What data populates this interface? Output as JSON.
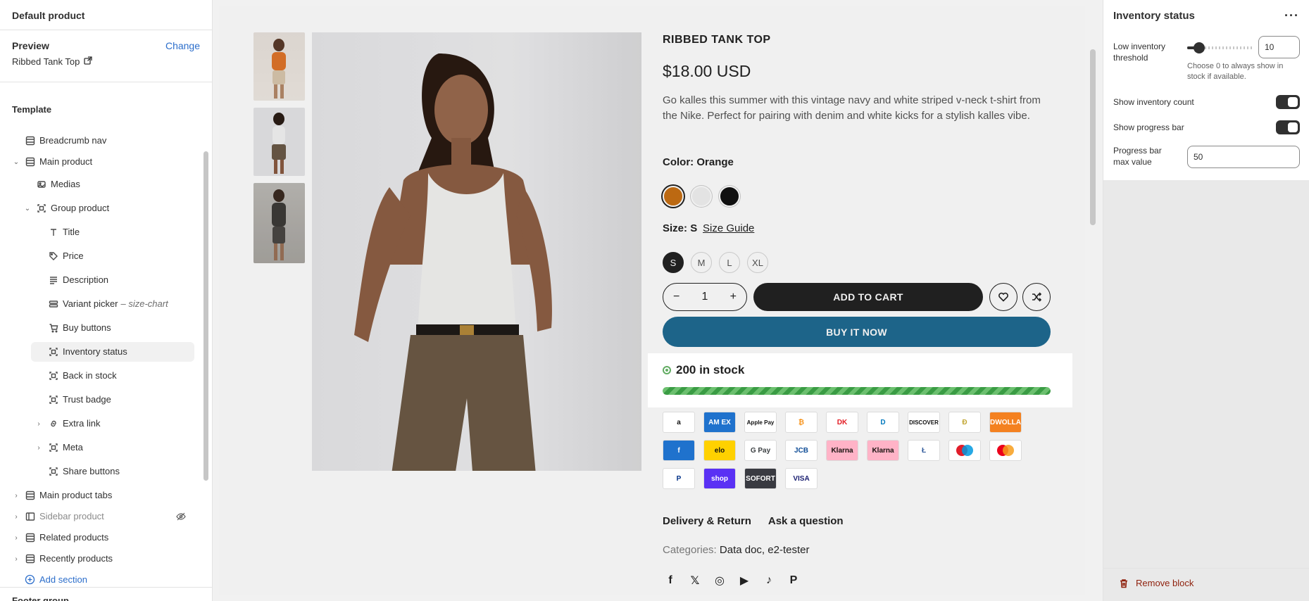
{
  "left_panel": {
    "title": "Default product",
    "preview_label": "Preview",
    "change_label": "Change",
    "preview_product": "Ribbed Tank Top",
    "template_label": "Template",
    "tree": [
      {
        "label": "Breadcrumb nav",
        "icon": "section-icon",
        "level": 1
      },
      {
        "label": "Main product",
        "icon": "section-icon",
        "level": 1,
        "expanded": true
      },
      {
        "label": "Medias",
        "icon": "media-icon",
        "level": 2
      },
      {
        "label": "Group product",
        "icon": "block-icon",
        "level": 2,
        "expanded": true
      },
      {
        "label": "Title",
        "icon": "text-icon",
        "level": 3
      },
      {
        "label": "Price",
        "icon": "price-tag-icon",
        "level": 3
      },
      {
        "label": "Description",
        "icon": "paragraph-icon",
        "level": 3
      },
      {
        "label": "Variant picker",
        "meta": "– size-chart",
        "icon": "variant-icon",
        "level": 3
      },
      {
        "label": "Buy buttons",
        "icon": "cart-icon",
        "level": 3
      },
      {
        "label": "Inventory status",
        "icon": "block-icon",
        "level": 3,
        "selected": true
      },
      {
        "label": "Back in stock",
        "icon": "block-icon",
        "level": 3
      },
      {
        "label": "Trust badge",
        "icon": "block-icon",
        "level": 3
      },
      {
        "label": "Extra link",
        "icon": "link-icon",
        "level": 3,
        "collapsed": true
      },
      {
        "label": "Meta",
        "icon": "block-icon",
        "level": 3,
        "collapsed": true
      },
      {
        "label": "Share buttons",
        "icon": "block-icon",
        "level": 3
      },
      {
        "label": "Main product tabs",
        "icon": "section-icon",
        "level": 1,
        "collapsed": true
      },
      {
        "label": "Sidebar product",
        "icon": "sidebar-icon",
        "level": 1,
        "collapsed": true,
        "hidden": true
      },
      {
        "label": "Related products",
        "icon": "section-icon",
        "level": 1,
        "collapsed": true
      },
      {
        "label": "Recently products",
        "icon": "section-icon",
        "level": 1,
        "collapsed": true
      }
    ],
    "add_section": "Add section",
    "footer_group": "Footer group"
  },
  "preview": {
    "product_title": "RIBBED TANK TOP",
    "price": "$18.00 USD",
    "description": "Go kalles this summer with this vintage navy and white striped v-neck t-shirt from the Nike. Perfect for pairing with denim and white kicks for a stylish kalles vibe.",
    "color_label": "Color:",
    "color_value": "Orange",
    "colors": [
      "#c87014",
      "#f2f2f2",
      "#111111"
    ],
    "size_label": "Size:",
    "size_value": "S",
    "size_guide": "Size Guide",
    "sizes": [
      "S",
      "M",
      "L",
      "XL"
    ],
    "quantity": "1",
    "qty_minus": "−",
    "qty_plus": "+",
    "add_to_cart": "ADD TO CART",
    "buy_now": "BUY IT NOW",
    "stock_text": "200 in stock",
    "stock_progress": 1.0,
    "payments": [
      {
        "name": "amazon",
        "label": "a",
        "bg": "#ffffff",
        "fg": "#111111"
      },
      {
        "name": "amex",
        "label": "AM EX",
        "bg": "#1f72cd",
        "fg": "#ffffff"
      },
      {
        "name": "apple-pay",
        "label": "Apple Pay",
        "bg": "#ffffff",
        "fg": "#111111"
      },
      {
        "name": "bitcoin",
        "label": "₿",
        "bg": "#ffffff",
        "fg": "#f7931a"
      },
      {
        "name": "dankort",
        "label": "DK",
        "bg": "#ffffff",
        "fg": "#e31b23"
      },
      {
        "name": "diners",
        "label": "D",
        "bg": "#ffffff",
        "fg": "#0079be"
      },
      {
        "name": "discover",
        "label": "DISCOVER",
        "bg": "#ffffff",
        "fg": "#111111"
      },
      {
        "name": "dogecoin",
        "label": "Ð",
        "bg": "#ffffff",
        "fg": "#c2a633"
      },
      {
        "name": "dwolla",
        "label": "DWOLLA",
        "bg": "#f48120",
        "fg": "#ffffff"
      },
      {
        "name": "forbrugsforeningen",
        "label": "f",
        "bg": "#1f72cd",
        "fg": "#ffffff"
      },
      {
        "name": "elo",
        "label": "elo",
        "bg": "#ffd100",
        "fg": "#111111"
      },
      {
        "name": "google-pay",
        "label": "G Pay",
        "bg": "#ffffff",
        "fg": "#3c4043"
      },
      {
        "name": "jcb",
        "label": "JCB",
        "bg": "#ffffff",
        "fg": "#0e4c96"
      },
      {
        "name": "klarna-1",
        "label": "Klarna",
        "bg": "#ffb3c7",
        "fg": "#17120f"
      },
      {
        "name": "klarna-2",
        "label": "Klarna",
        "bg": "#ffb3c7",
        "fg": "#17120f"
      },
      {
        "name": "litecoin",
        "label": "Ł",
        "bg": "#ffffff",
        "fg": "#345d9d"
      },
      {
        "name": "maestro",
        "label": "",
        "bg": "#ffffff",
        "fg": "#111111"
      },
      {
        "name": "mastercard",
        "label": "",
        "bg": "#ffffff",
        "fg": "#111111"
      },
      {
        "name": "paypal",
        "label": "P",
        "bg": "#ffffff",
        "fg": "#003087"
      },
      {
        "name": "shop-pay",
        "label": "shop",
        "bg": "#5a31f4",
        "fg": "#ffffff"
      },
      {
        "name": "sofort",
        "label": "SOFORT",
        "bg": "#393a41",
        "fg": "#ffffff"
      },
      {
        "name": "visa",
        "label": "VISA",
        "bg": "#ffffff",
        "fg": "#1a1f71"
      }
    ],
    "delivery_link": "Delivery & Return",
    "ask_link": "Ask a question",
    "categories_label": "Categories:",
    "categories_value": "Data doc, e2-tester",
    "social": [
      "facebook-icon",
      "x-icon",
      "instagram-icon",
      "youtube-icon",
      "tiktok-icon",
      "pinterest-icon"
    ],
    "social_glyphs": [
      "f",
      "𝕏",
      "◎",
      "▶",
      "♪",
      "P"
    ]
  },
  "right_panel": {
    "title": "Inventory status",
    "more": "···",
    "low_threshold_label": "Low inventory threshold",
    "low_threshold_value": "10",
    "low_threshold_slider": 0.1,
    "low_threshold_help": "Choose 0 to always show in stock if available.",
    "show_count_label": "Show inventory count",
    "show_count": true,
    "show_bar_label": "Show progress bar",
    "show_bar": true,
    "bar_max_label": "Progress bar max value",
    "bar_max_value": "50",
    "remove_block": "Remove block"
  }
}
